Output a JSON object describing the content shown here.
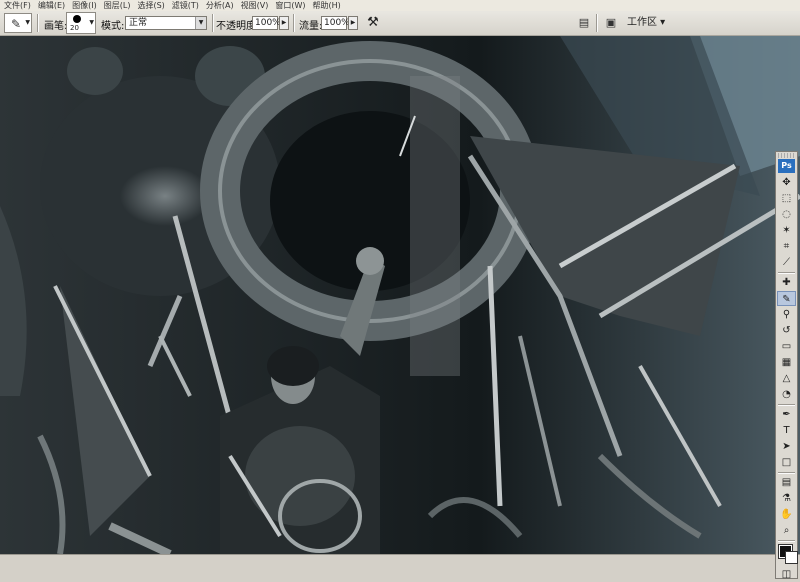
{
  "menu": [
    "文件(F)",
    "编辑(E)",
    "图像(I)",
    "图层(L)",
    "选择(S)",
    "滤镜(T)",
    "分析(A)",
    "视图(V)",
    "窗口(W)",
    "帮助(H)"
  ],
  "options": {
    "brush_label": "画笔:",
    "brush_size": "20",
    "mode_label": "模式:",
    "mode_value": "正常",
    "opacity_label": "不透明度:",
    "opacity_value": "100%",
    "flow_label": "流量:",
    "flow_value": "100%",
    "workspace_label": "工作区 ▾"
  },
  "toolbox": {
    "logo": "Ps"
  },
  "colors": {
    "foreground": "#111111",
    "background": "#ffffff",
    "accent": "#2a6fbe"
  }
}
